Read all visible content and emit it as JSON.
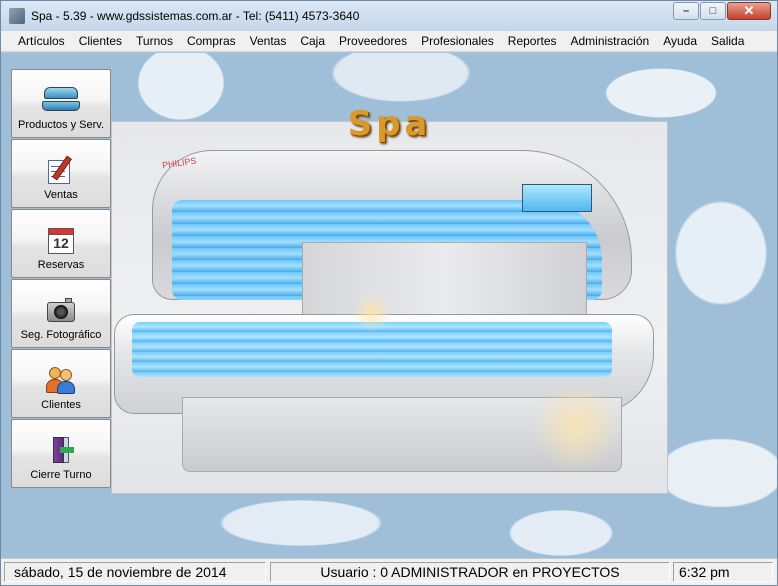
{
  "window": {
    "title": "Spa -  5.39 - www.gdssistemas.com.ar - Tel: (5411) 4573-3640",
    "controls": {
      "minimize": "–",
      "maximize": "□",
      "close": "✕"
    }
  },
  "menu": [
    "Artículos",
    "Clientes",
    "Turnos",
    "Compras",
    "Ventas",
    "Caja",
    "Proveedores",
    "Profesionales",
    "Reportes",
    "Administración",
    "Ayuda",
    "Salida"
  ],
  "sidebar": {
    "items": [
      {
        "label": "Productos y Serv.",
        "icon": "tanning-bed-icon"
      },
      {
        "label": "Ventas",
        "icon": "pen-notepad-icon"
      },
      {
        "label": "Reservas",
        "icon": "calendar-icon"
      },
      {
        "label": "Seg. Fotográfico",
        "icon": "camera-icon"
      },
      {
        "label": "Clientes",
        "icon": "users-icon"
      },
      {
        "label": "Cierre Turno",
        "icon": "exit-door-icon"
      }
    ],
    "calendar_day": "12"
  },
  "main": {
    "title": "Spa",
    "image_brand": "PHILIPS"
  },
  "status": {
    "date": "sábado, 15 de noviembre de 2014",
    "user": "Usuario : 0 ADMINISTRADOR en PROYECTOS",
    "time": "6:32 pm"
  }
}
